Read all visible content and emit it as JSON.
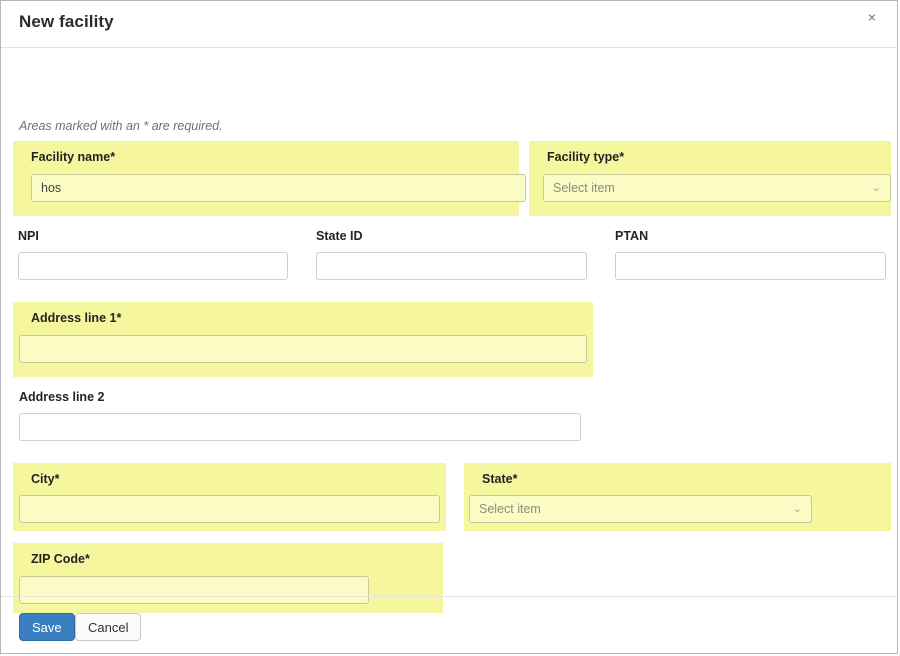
{
  "window": {
    "border_color": "#b6b6b6"
  },
  "header": {
    "title": "New facility",
    "close_label": "×"
  },
  "body": {
    "required_note": "Areas marked with an * are required."
  },
  "fields": {
    "facility_name": {
      "label": "Facility name*",
      "value": "hos",
      "placeholder": "",
      "required": true
    },
    "facility_type": {
      "label": "Facility type*",
      "value": "Select item",
      "required": true
    },
    "npi": {
      "label": "NPI",
      "value": "",
      "placeholder": "",
      "required": false
    },
    "state_id": {
      "label": "State ID",
      "value": "",
      "placeholder": "",
      "required": false
    },
    "ptan": {
      "label": "PTAN",
      "value": "",
      "placeholder": "",
      "required": false
    },
    "address_line_1": {
      "label": "Address line 1*",
      "value": "",
      "placeholder": "",
      "required": true
    },
    "address_line_2": {
      "label": "Address line 2",
      "value": "",
      "placeholder": "",
      "required": false
    },
    "city": {
      "label": "City*",
      "value": "",
      "placeholder": "",
      "required": true
    },
    "state": {
      "label": "State*",
      "value": "Select item",
      "required": true
    },
    "zip_code": {
      "label": "ZIP Code*",
      "value": "",
      "placeholder": "",
      "required": true
    }
  },
  "icons": {
    "chevron_down": "⌄"
  },
  "footer": {
    "save_label": "Save",
    "cancel_label": "Cancel"
  },
  "colors": {
    "required_highlight": "#f6f69f",
    "required_field_fill": "#fbfbc4",
    "save_button": "#3a7fbf"
  }
}
